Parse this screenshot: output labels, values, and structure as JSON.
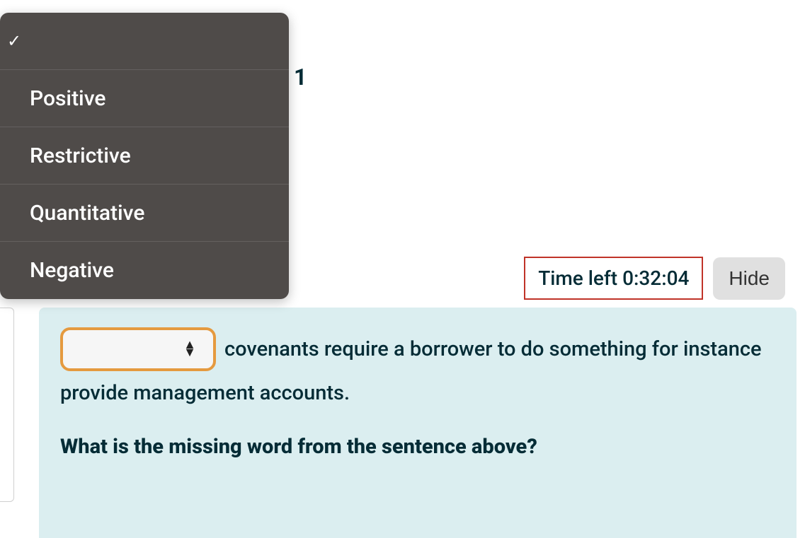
{
  "dropdown": {
    "selected_label": "",
    "options": [
      {
        "label": "Positive"
      },
      {
        "label": "Restrictive"
      },
      {
        "label": "Quantitative"
      },
      {
        "label": "Negative"
      }
    ]
  },
  "behind_number": "1",
  "timer": {
    "label": "Time left 0:32:04",
    "hide_label": "Hide"
  },
  "question": {
    "sentence_part1": "covenants require a borrower to do something for instance",
    "sentence_part2": "provide management accounts.",
    "prompt": "What is the missing word from the sentence above?"
  }
}
